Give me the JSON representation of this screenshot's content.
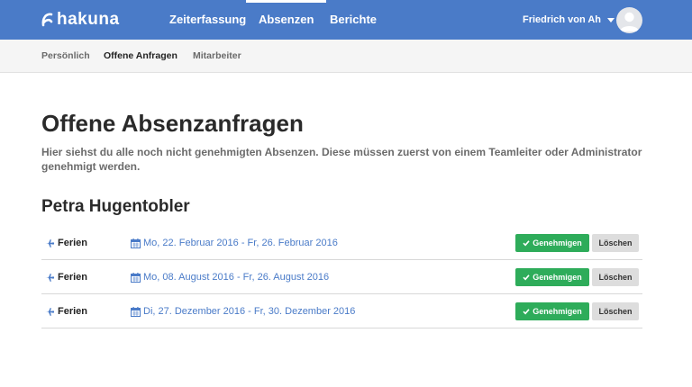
{
  "app": {
    "logo_text": "hakuna"
  },
  "nav": {
    "items": [
      {
        "label": "Zeiterfassung",
        "active": false
      },
      {
        "label": "Absenzen",
        "active": true
      },
      {
        "label": "Berichte",
        "active": false
      }
    ],
    "user_name": "Friedrich von Ah"
  },
  "subnav": {
    "items": [
      {
        "label": "Persönlich",
        "active": false
      },
      {
        "label": "Offene Anfragen",
        "active": true
      },
      {
        "label": "Mitarbeiter",
        "active": false
      }
    ]
  },
  "main": {
    "title": "Offene Absenzanfragen",
    "description": "Hier siehst du alle noch nicht genehmigten Absenzen. Diese müssen zuerst von einem Teamleiter oder Administrator genehmigt werden.",
    "person": "Petra Hugentobler",
    "requests": [
      {
        "type": "Ferien",
        "dates": "Mo, 22. Februar 2016 - Fr, 26. Februar 2016",
        "approve_label": "Genehmigen",
        "delete_label": "Löschen"
      },
      {
        "type": "Ferien",
        "dates": "Mo, 08. August 2016 - Fr, 26. August 2016",
        "approve_label": "Genehmigen",
        "delete_label": "Löschen"
      },
      {
        "type": "Ferien",
        "dates": "Di, 27. Dezember 2016 - Fr, 30. Dezember 2016",
        "approve_label": "Genehmigen",
        "delete_label": "Löschen"
      }
    ]
  },
  "icons": {
    "type_icon": "plane-icon",
    "date_icon": "calendar-icon",
    "approve_icon": "check-icon",
    "user_caret": "caret-down-icon"
  },
  "colors": {
    "brand": "#4a7bc8",
    "approve": "#2eac5a",
    "delete": "#dddddd",
    "link": "#4a7bc8"
  }
}
